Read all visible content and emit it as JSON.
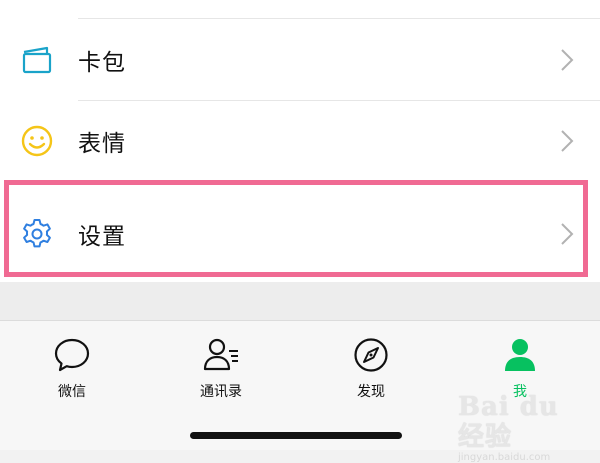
{
  "menu": {
    "items": [
      {
        "label": "卡包",
        "icon": "card-wallet-icon"
      },
      {
        "label": "表情",
        "icon": "smiley-icon"
      },
      {
        "label": "设置",
        "icon": "gear-icon"
      }
    ]
  },
  "tabbar": {
    "tabs": [
      {
        "label": "微信",
        "icon": "chat-bubble-icon",
        "active": false
      },
      {
        "label": "通讯录",
        "icon": "contacts-icon",
        "active": false
      },
      {
        "label": "发现",
        "icon": "compass-icon",
        "active": false
      },
      {
        "label": "我",
        "icon": "person-icon",
        "active": true
      }
    ]
  },
  "watermark": {
    "brand": "Bai du 经验",
    "url": "jingyan.baidu.com"
  },
  "colors": {
    "accent": "#07c160",
    "highlight": "#f06a93",
    "gear": "#2f7fe0",
    "wallet": "#1aa3c9",
    "smiley": "#f5c518"
  }
}
